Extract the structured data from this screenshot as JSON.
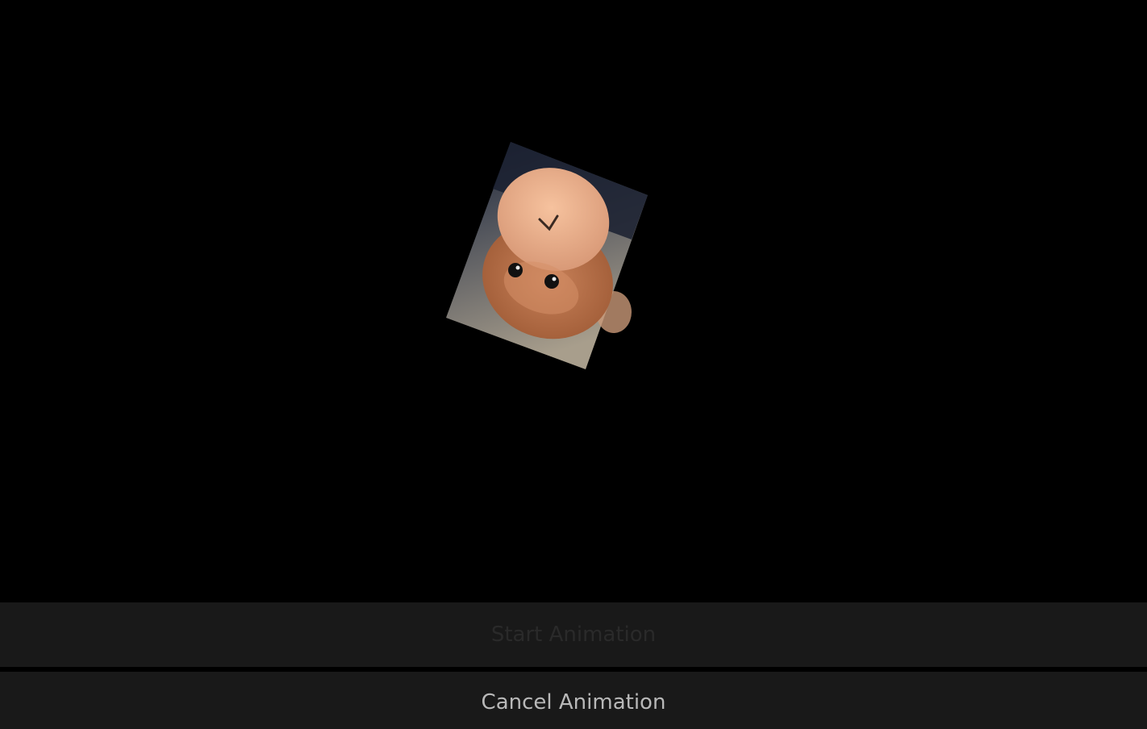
{
  "buttons": {
    "start_label": "Start Animation",
    "cancel_label": "Cancel Animation",
    "start_enabled": false
  },
  "image": {
    "subject": "plush-monkey-photo",
    "rotation_deg": 200
  },
  "colors": {
    "background": "#000000",
    "button_bg": "#191919",
    "start_text": "#2a2a2a",
    "cancel_text": "#b8b8b8"
  }
}
